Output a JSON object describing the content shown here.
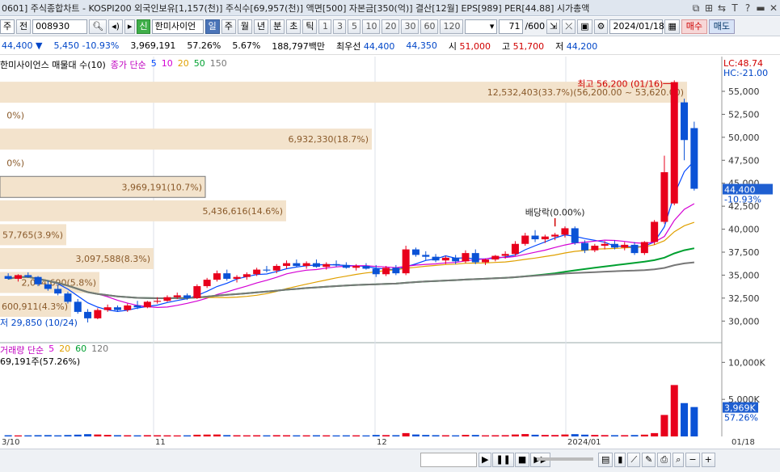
{
  "window": {
    "title": "0601] 주식종합차트 - KOSPI200 외국인보유[1,157(천)] 주식수[69,957(천)] 액면[500] 자본금[350(억)] 결산[12월] EPS[989] PER[44.88] 시가총액",
    "buttons": [
      "⧉",
      "⊞",
      "⇆",
      "T",
      "?",
      "▬",
      "✕"
    ]
  },
  "toolbar": {
    "market": "주",
    "prev": "전",
    "code": "008930",
    "stock_name": "한미사이언",
    "periods": [
      "일",
      "주",
      "월",
      "년",
      "분",
      "초",
      "틱"
    ],
    "active_period": "일",
    "intervals": [
      "1",
      "3",
      "5",
      "10",
      "20",
      "30",
      "60",
      "120"
    ],
    "count": "71",
    "count_total": "/600",
    "date": "2024/01/18",
    "buy_label": "매수",
    "sell_label": "매도"
  },
  "pricebar": {
    "price": "44,400",
    "arrow": "▼",
    "change": "5,450",
    "change_pct": "-10.93%",
    "volume": "3,969,191",
    "vol_ratio": "57.26%",
    "turnover": "5.67%",
    "amount": "188,797백만",
    "best_label": "최우선",
    "ask": "44,400",
    "bid": "44,350",
    "open_label": "시",
    "open": "51,000",
    "high_label": "고",
    "high": "51,700",
    "low_label": "저",
    "low": "44,200"
  },
  "legend": {
    "title": "한미사이언스 매물대 수(10)",
    "ma_label": "종가 단순",
    "ma": [
      {
        "period": "5",
        "color": "#0047ff"
      },
      {
        "period": "10",
        "color": "#d400d4"
      },
      {
        "period": "20",
        "color": "#e0a000"
      },
      {
        "period": "50",
        "color": "#00a030"
      },
      {
        "period": "150",
        "color": "#777777"
      }
    ]
  },
  "volume_legend": {
    "title": "거래량 단순",
    "ma": [
      {
        "period": "5",
        "color": "#d400d4"
      },
      {
        "period": "20",
        "color": "#e0a000"
      },
      {
        "period": "60",
        "color": "#00a030"
      },
      {
        "period": "120",
        "color": "#777777"
      }
    ],
    "current": "69,191주(57.26%)"
  },
  "volume_profile": [
    {
      "label": "12,532,403(33.7%)(56,200.00 ~ 53,620.00)",
      "price": 54900
    },
    {
      "label": "0%)",
      "price": 52400
    },
    {
      "label": "6,932,330(18.7%)",
      "price": 49800
    },
    {
      "label": "0%)",
      "price": 47200
    },
    {
      "label": "3,969,191(10.7%)",
      "price": 44600
    },
    {
      "label": "5,436,616(14.6%)",
      "price": 42000
    },
    {
      "label": "57,765(3.9%)",
      "price": 39400
    },
    {
      "label": "3,097,588(8.3%)",
      "price": 36800
    },
    {
      "label": "2,044,690(5.8%)",
      "price": 34200
    },
    {
      "label": "600,911(4.3%)",
      "price": 31600
    }
  ],
  "annotations": {
    "high": "최고 56,200 (01/16)",
    "low": "저 29,850 (10/24)",
    "dividend": "배당락(0.00%)"
  },
  "price_scale": {
    "lc": "LC:48.74",
    "hc": "HC:-21.00",
    "ticks": [
      "55,000",
      "52,500",
      "50,000",
      "47,500",
      "45,000",
      "42,500",
      "40,000",
      "37,500",
      "35,000",
      "32,500",
      "30,000"
    ],
    "current": "44,400",
    "current_pct": "-10.93%"
  },
  "volume_scale": {
    "ticks": [
      "10,000K",
      "5,000K"
    ],
    "current": "3,969K",
    "current_pct": "57.26%"
  },
  "date_axis": [
    "3/10",
    "11",
    "12",
    "2024/01",
    "01/18"
  ],
  "colors": {
    "up": "#e8001c",
    "down": "#0a52d6",
    "profile": "#f3e3cc"
  },
  "chart_data": {
    "type": "candlestick",
    "candles": [
      [
        34900,
        35200,
        34500,
        34600
      ],
      [
        34600,
        35100,
        34300,
        35000
      ],
      [
        35000,
        35300,
        34700,
        34800
      ],
      [
        34800,
        34900,
        33800,
        34000
      ],
      [
        34000,
        34400,
        33300,
        33500
      ],
      [
        33500,
        33900,
        32800,
        33000
      ],
      [
        33000,
        33200,
        31900,
        32100
      ],
      [
        32100,
        32400,
        30800,
        31000
      ],
      [
        31000,
        31300,
        29850,
        30300
      ],
      [
        30300,
        31400,
        30200,
        31200
      ],
      [
        31200,
        31800,
        31000,
        31500
      ],
      [
        31500,
        31700,
        31000,
        31200
      ],
      [
        31200,
        31900,
        31000,
        31700
      ],
      [
        31700,
        32200,
        31300,
        31500
      ],
      [
        31500,
        32200,
        31400,
        32100
      ],
      [
        32100,
        32600,
        31900,
        32200
      ],
      [
        32200,
        32800,
        32100,
        32600
      ],
      [
        32600,
        33100,
        32400,
        32800
      ],
      [
        32800,
        33000,
        32300,
        32500
      ],
      [
        32500,
        34000,
        32400,
        33800
      ],
      [
        33800,
        34700,
        33600,
        34500
      ],
      [
        34500,
        35500,
        34300,
        35200
      ],
      [
        35200,
        35600,
        34400,
        34600
      ],
      [
        34600,
        35000,
        34200,
        34800
      ],
      [
        34800,
        35300,
        34500,
        35100
      ],
      [
        35100,
        35800,
        34900,
        35600
      ],
      [
        35600,
        36000,
        35300,
        35500
      ],
      [
        35500,
        36200,
        35200,
        36000
      ],
      [
        36000,
        36600,
        35700,
        36300
      ],
      [
        36300,
        36700,
        35900,
        36000
      ],
      [
        36000,
        36500,
        35700,
        36300
      ],
      [
        36300,
        36700,
        35800,
        35900
      ],
      [
        35900,
        36400,
        35600,
        36200
      ],
      [
        36200,
        36600,
        35900,
        36100
      ],
      [
        36100,
        36400,
        35700,
        35800
      ],
      [
        35800,
        36200,
        35500,
        36000
      ],
      [
        36000,
        36300,
        35600,
        35700
      ],
      [
        35700,
        36100,
        34800,
        35100
      ],
      [
        35100,
        36000,
        34900,
        35800
      ],
      [
        35800,
        36100,
        35000,
        35200
      ],
      [
        35200,
        38200,
        35000,
        37800
      ],
      [
        37800,
        38000,
        37000,
        37200
      ],
      [
        37200,
        37600,
        36600,
        37000
      ],
      [
        37000,
        37300,
        36400,
        36600
      ],
      [
        36600,
        37100,
        36200,
        36900
      ],
      [
        36900,
        37200,
        36200,
        36500
      ],
      [
        36500,
        37700,
        36300,
        37400
      ],
      [
        37400,
        37800,
        36200,
        36400
      ],
      [
        36400,
        36800,
        36100,
        36700
      ],
      [
        36700,
        37200,
        36500,
        37100
      ],
      [
        37100,
        37600,
        36800,
        37300
      ],
      [
        37300,
        38700,
        37100,
        38400
      ],
      [
        38400,
        39600,
        38200,
        39300
      ],
      [
        39300,
        39900,
        38600,
        38900
      ],
      [
        38900,
        39400,
        38500,
        39200
      ],
      [
        39200,
        39600,
        38800,
        39400
      ],
      [
        39400,
        40300,
        39100,
        40100
      ],
      [
        40100,
        40300,
        38300,
        38500
      ],
      [
        38500,
        38800,
        37400,
        37700
      ],
      [
        37700,
        38400,
        37500,
        38200
      ],
      [
        38200,
        38700,
        37800,
        38400
      ],
      [
        38400,
        38800,
        37800,
        38000
      ],
      [
        38000,
        38600,
        37700,
        38300
      ],
      [
        38300,
        38600,
        37200,
        37400
      ],
      [
        37400,
        38700,
        37200,
        38600
      ],
      [
        38600,
        41000,
        38300,
        40800
      ],
      [
        40800,
        48000,
        40600,
        46200
      ],
      [
        42800,
        56200,
        42600,
        56000
      ],
      [
        53800,
        54200,
        47500,
        49700
      ],
      [
        51000,
        51700,
        44200,
        44400
      ]
    ],
    "volumes": [
      160,
      140,
      150,
      170,
      180,
      150,
      190,
      240,
      310,
      260,
      210,
      170,
      160,
      150,
      170,
      160,
      150,
      140,
      150,
      230,
      250,
      260,
      180,
      160,
      150,
      160,
      150,
      170,
      160,
      150,
      150,
      160,
      150,
      140,
      150,
      150,
      140,
      200,
      180,
      170,
      450,
      260,
      200,
      170,
      160,
      150,
      210,
      200,
      150,
      160,
      170,
      260,
      320,
      230,
      200,
      190,
      260,
      310,
      240,
      200,
      180,
      170,
      170,
      190,
      240,
      450,
      2900,
      6939,
      4500,
      3969
    ],
    "price_ylim": [
      28000,
      57200
    ],
    "volume_ylim": [
      0,
      12000
    ],
    "series": [
      {
        "name": "5"
      },
      {
        "name": "10"
      },
      {
        "name": "20"
      },
      {
        "name": "50"
      },
      {
        "name": "150"
      }
    ]
  }
}
